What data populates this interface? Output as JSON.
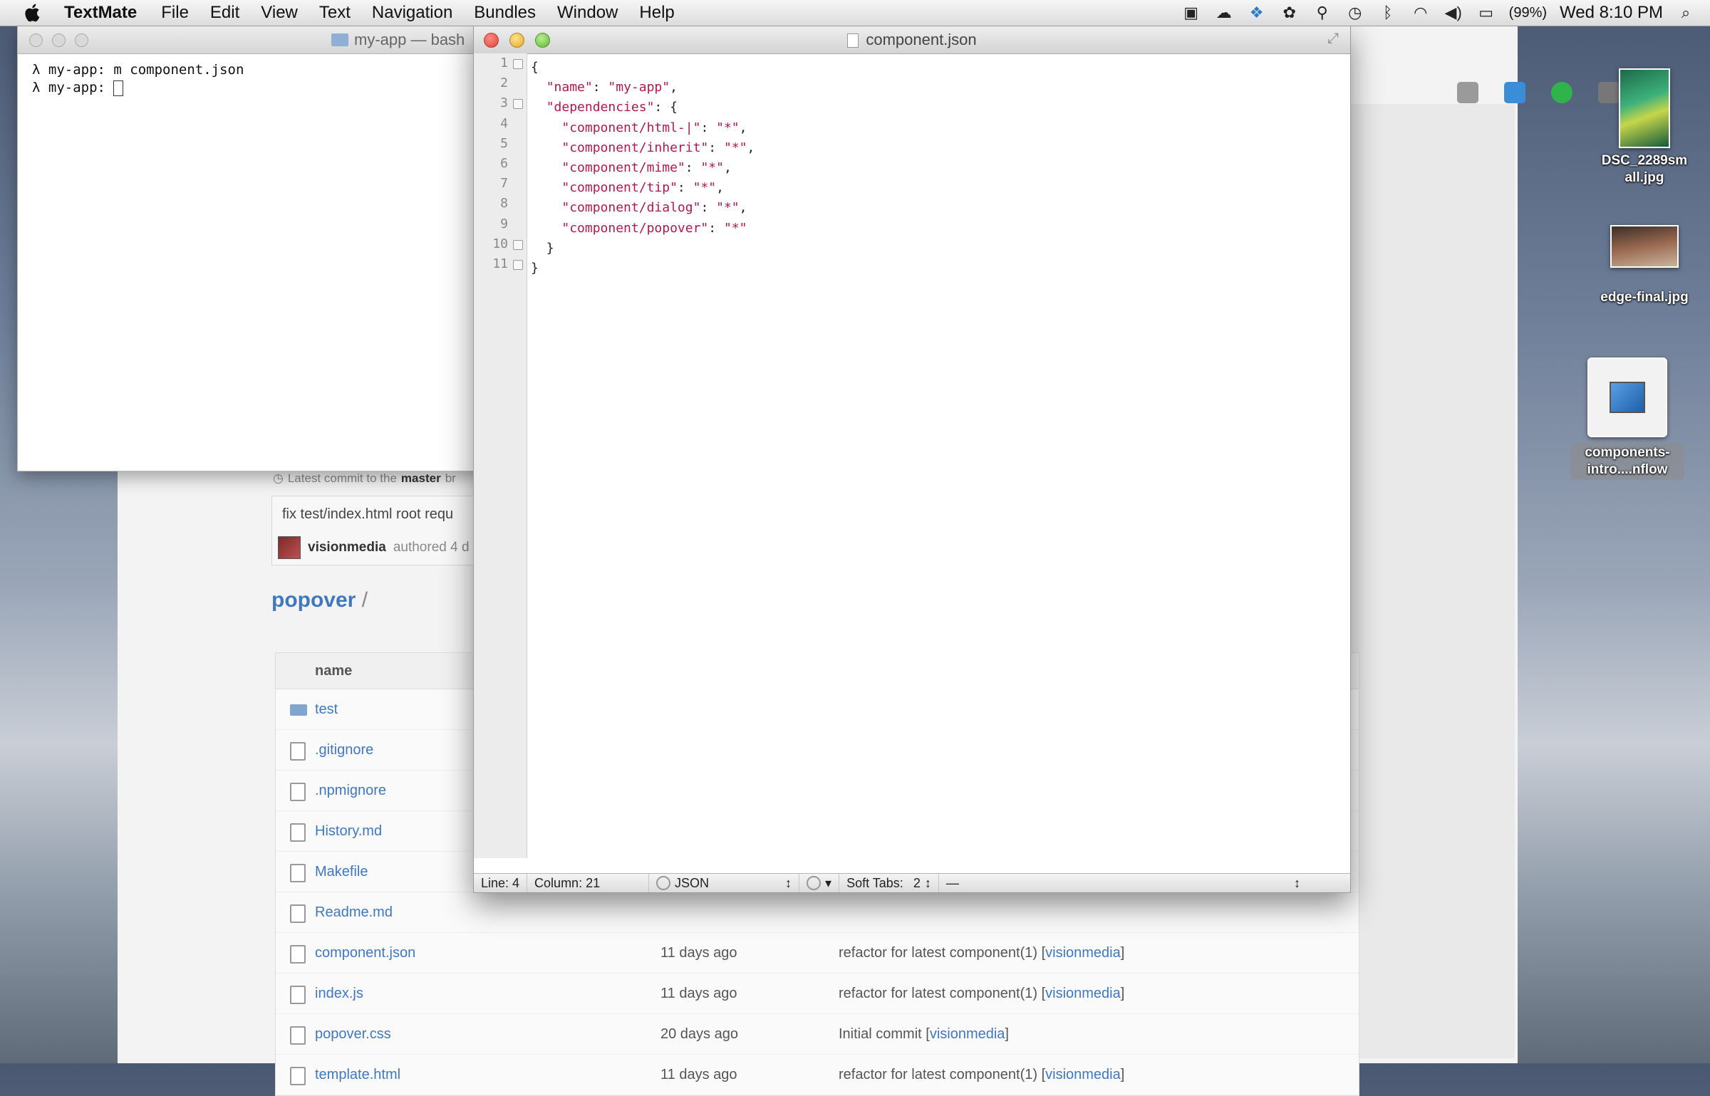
{
  "menubar": {
    "app_name": "TextMate",
    "items": [
      "File",
      "Edit",
      "View",
      "Text",
      "Navigation",
      "Bundles",
      "Window",
      "Help"
    ],
    "battery": "(99%)",
    "clock": "Wed 8:10 PM"
  },
  "terminal": {
    "title": "my-app — bash",
    "lines": [
      "λ my-app: m component.json",
      "λ my-app: "
    ]
  },
  "editor": {
    "title": "component.json",
    "line_numbers": [
      "1",
      "2",
      "3",
      "4",
      "5",
      "6",
      "7",
      "8",
      "9",
      "10",
      "11"
    ],
    "code": [
      {
        "indent": "",
        "key": "",
        "value": "",
        "punct": "{"
      },
      {
        "indent": "  ",
        "key": "\"name\"",
        "sep": ": ",
        "value": "\"my-app\"",
        "punct": ","
      },
      {
        "indent": "  ",
        "key": "\"dependencies\"",
        "sep": ": ",
        "value": "",
        "punct": "{"
      },
      {
        "indent": "    ",
        "key": "\"component/html-|\"",
        "sep": ": ",
        "value": "\"*\"",
        "punct": ","
      },
      {
        "indent": "    ",
        "key": "\"component/inherit\"",
        "sep": ": ",
        "value": "\"*\"",
        "punct": ","
      },
      {
        "indent": "    ",
        "key": "\"component/mime\"",
        "sep": ": ",
        "value": "\"*\"",
        "punct": ","
      },
      {
        "indent": "    ",
        "key": "\"component/tip\"",
        "sep": ": ",
        "value": "\"*\"",
        "punct": ","
      },
      {
        "indent": "    ",
        "key": "\"component/dialog\"",
        "sep": ": ",
        "value": "\"*\"",
        "punct": ","
      },
      {
        "indent": "    ",
        "key": "\"component/popover\"",
        "sep": ": ",
        "value": "\"*\"",
        "punct": ""
      },
      {
        "indent": "  ",
        "key": "",
        "value": "",
        "punct": "}"
      },
      {
        "indent": "",
        "key": "",
        "value": "",
        "punct": "}"
      }
    ],
    "status": {
      "line": "Line: 4",
      "column": "Column: 21",
      "language": "JSON",
      "soft_tabs": "Soft Tabs:",
      "tab_size": "2",
      "symbol": "—"
    }
  },
  "browser": {
    "latest_commit_prefix": "Latest commit to the",
    "latest_commit_branch": "master",
    "latest_commit_suffix": "br",
    "commit_message": "fix test/index.html root requ",
    "commit_author": "visionmedia",
    "commit_authored": "authored 4 d",
    "repo_name": "popover",
    "repo_sep": "/",
    "table_header": "name",
    "files": [
      {
        "name": "test",
        "type": "folder",
        "age": "",
        "message": "",
        "author": ""
      },
      {
        "name": ".gitignore",
        "type": "file",
        "age": "",
        "message": "",
        "author": ""
      },
      {
        "name": ".npmignore",
        "type": "file",
        "age": "",
        "message": "",
        "author": ""
      },
      {
        "name": "History.md",
        "type": "file",
        "age": "",
        "message": "",
        "author": ""
      },
      {
        "name": "Makefile",
        "type": "file",
        "age": "",
        "message": "",
        "author": ""
      },
      {
        "name": "Readme.md",
        "type": "file",
        "age": "",
        "message": "",
        "author": ""
      },
      {
        "name": "component.json",
        "type": "file",
        "age": "11 days ago",
        "message": "refactor for latest component(1) [",
        "author": "visionmedia"
      },
      {
        "name": "index.js",
        "type": "file",
        "age": "11 days ago",
        "message": "refactor for latest component(1) [",
        "author": "visionmedia"
      },
      {
        "name": "popover.css",
        "type": "file",
        "age": "20 days ago",
        "message": "Initial commit [",
        "author": "visionmedia"
      },
      {
        "name": "template.html",
        "type": "file",
        "age": "11 days ago",
        "message": "refactor for latest component(1) [",
        "author": "visionmedia"
      }
    ]
  },
  "desktop": [
    {
      "label1": "DSC_2289sm",
      "label2": "all.jpg"
    },
    {
      "label1": "edge-final.jpg",
      "label2": ""
    },
    {
      "label1": "components-",
      "label2": "intro....nflow"
    }
  ]
}
